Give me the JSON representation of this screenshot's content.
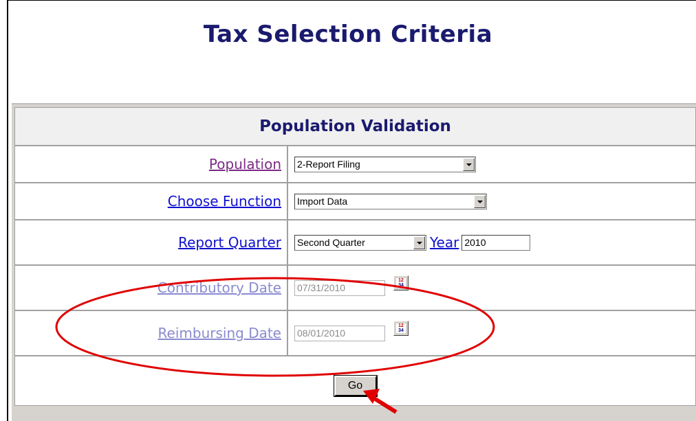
{
  "page": {
    "title": "Tax Selection Criteria"
  },
  "form": {
    "header": "Population Validation",
    "population": {
      "label": "Population",
      "value": "2-Report Filing"
    },
    "choose_function": {
      "label": "Choose Function",
      "value": "Import Data"
    },
    "report_quarter": {
      "label": "Report Quarter",
      "value": "Second Quarter"
    },
    "year": {
      "label": "Year",
      "value": "2010"
    },
    "contributory_date": {
      "label": "Contributory Date",
      "value": "07/31/2010"
    },
    "reimbursing_date": {
      "label": "Reimbursing Date",
      "value": "08/01/2010"
    },
    "go_button": "Go"
  },
  "icons": {
    "calendar": "calendar-icon",
    "calendar_glyph_top": "12",
    "calendar_glyph_bottom": "34"
  },
  "annotations": {
    "highlight_color": "#e00000"
  }
}
